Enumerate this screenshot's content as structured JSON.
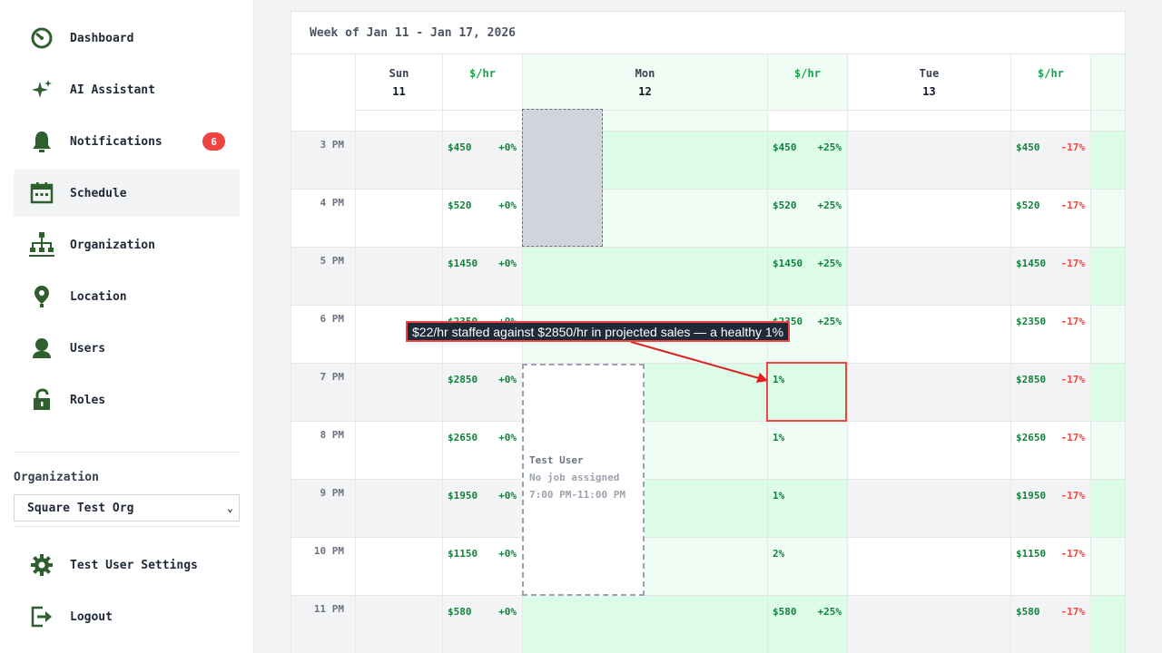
{
  "sidebar": {
    "items": [
      {
        "label": "Dashboard",
        "icon": "dashboard-icon"
      },
      {
        "label": "AI Assistant",
        "icon": "sparkle-icon"
      },
      {
        "label": "Notifications",
        "icon": "bell-icon",
        "badge": "6"
      },
      {
        "label": "Schedule",
        "icon": "calendar-icon",
        "active": true
      },
      {
        "label": "Organization",
        "icon": "org-chart-icon"
      },
      {
        "label": "Location",
        "icon": "location-pin-icon"
      },
      {
        "label": "Users",
        "icon": "user-icon"
      },
      {
        "label": "Roles",
        "icon": "lock-icon"
      }
    ],
    "org_label": "Organization",
    "org_selected": "Square Test Org",
    "settings_label": "Test User Settings",
    "logout_label": "Logout"
  },
  "schedule": {
    "week_title": "Week of Jan 11 - Jan 17, 2026",
    "columns": [
      {
        "day": "Sun",
        "date": "11"
      },
      {
        "rate": "$/hr"
      },
      {
        "day": "Mon",
        "date": "12"
      },
      {
        "rate": "$/hr"
      },
      {
        "day": "Tue",
        "date": "13"
      },
      {
        "rate": "$/hr"
      }
    ],
    "rows": [
      {
        "time": "3 PM",
        "sun_val": "$450",
        "sun_pct": "+0%",
        "mon_val": "$450",
        "mon_pct": "+25%",
        "tue_val": "$450",
        "tue_pct": "-17%"
      },
      {
        "time": "4 PM",
        "sun_val": "$520",
        "sun_pct": "+0%",
        "mon_val": "$520",
        "mon_pct": "+25%",
        "tue_val": "$520",
        "tue_pct": "-17%"
      },
      {
        "time": "5 PM",
        "sun_val": "$1450",
        "sun_pct": "+0%",
        "mon_val": "$1450",
        "mon_pct": "+25%",
        "tue_val": "$1450",
        "tue_pct": "-17%"
      },
      {
        "time": "6 PM",
        "sun_val": "$2350",
        "sun_pct": "+0%",
        "mon_val": "$2350",
        "mon_pct": "+25%",
        "tue_val": "$2350",
        "tue_pct": "-17%"
      },
      {
        "time": "7 PM",
        "sun_val": "$2850",
        "sun_pct": "+0%",
        "mon_val": "1%",
        "mon_pct": "",
        "tue_val": "$2850",
        "tue_pct": "-17%"
      },
      {
        "time": "8 PM",
        "sun_val": "$2650",
        "sun_pct": "+0%",
        "mon_val": "1%",
        "mon_pct": "",
        "tue_val": "$2650",
        "tue_pct": "-17%"
      },
      {
        "time": "9 PM",
        "sun_val": "$1950",
        "sun_pct": "+0%",
        "mon_val": "1%",
        "mon_pct": "",
        "tue_val": "$1950",
        "tue_pct": "-17%"
      },
      {
        "time": "10 PM",
        "sun_val": "$1150",
        "sun_pct": "+0%",
        "mon_val": "2%",
        "mon_pct": "",
        "tue_val": "$1150",
        "tue_pct": "-17%"
      },
      {
        "time": "11 PM",
        "sun_val": "$580",
        "sun_pct": "+0%",
        "mon_val": "$580",
        "mon_pct": "+25%",
        "tue_val": "$580",
        "tue_pct": "-17%"
      }
    ],
    "shift": {
      "name": "Test User",
      "job": "No job assigned",
      "time": "7:00 PM-11:00 PM"
    },
    "callout": "$22/hr staffed against $2850/hr in projected sales — a healthy 1%"
  },
  "colors": {
    "accent_green": "#16a34a",
    "badge_red": "#ef4444",
    "icon_green": "#2f5e2f"
  }
}
